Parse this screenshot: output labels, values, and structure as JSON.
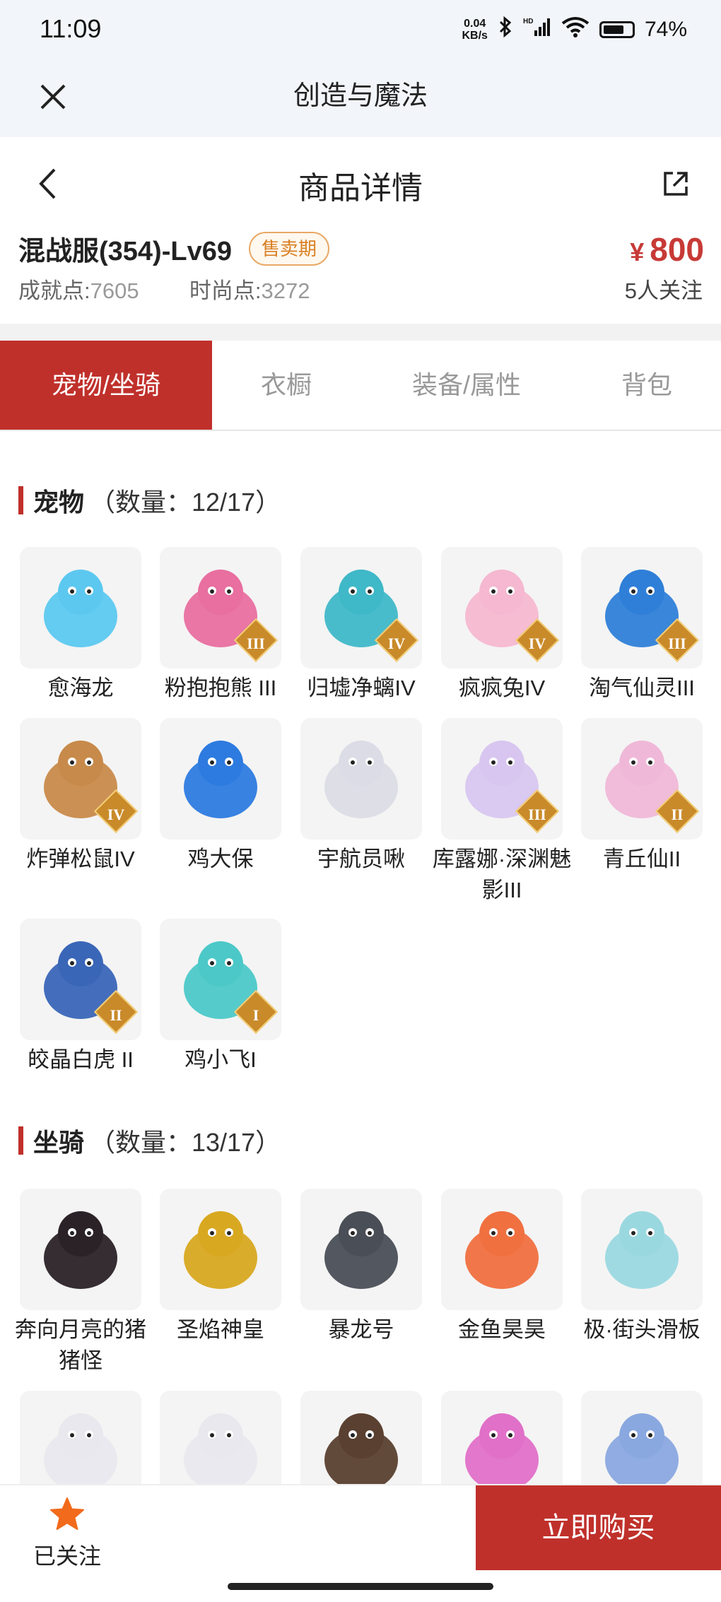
{
  "status": {
    "time": "11:09",
    "net_speed": "0.04",
    "net_unit": "KB/s",
    "battery": "74%",
    "battery_level": 0.74
  },
  "app": {
    "title": "创造与魔法"
  },
  "nav": {
    "title": "商品详情"
  },
  "listing": {
    "server": "混战服(354)-Lv69",
    "badge": "售卖期",
    "price_symbol": "¥",
    "price": "800",
    "achievement_label": "成就点:",
    "achievement_value": "7605",
    "fashion_label": "时尚点:",
    "fashion_value": "3272",
    "followers": "5人关注"
  },
  "tabs": [
    {
      "label": "宠物/坐骑",
      "active": true
    },
    {
      "label": "衣橱",
      "active": false
    },
    {
      "label": "装备/属性",
      "active": false
    },
    {
      "label": "背包",
      "active": false
    }
  ],
  "pets": {
    "title": "宠物",
    "count": "（数量：12/17）",
    "items": [
      {
        "name": "愈海龙",
        "rank": "",
        "color": "#5cc8f0",
        "icon": "ice-dragon-icon"
      },
      {
        "name": "粉抱抱熊 III",
        "rank": "III",
        "color": "#e86fa0",
        "icon": "pink-bear-icon"
      },
      {
        "name": "归墟净螭IV",
        "rank": "IV",
        "color": "#3fb8c8",
        "icon": "jade-dragon-icon"
      },
      {
        "name": "疯疯兔IV",
        "rank": "IV",
        "color": "#f5b8d0",
        "icon": "rabbit-icon"
      },
      {
        "name": "淘气仙灵III",
        "rank": "III",
        "color": "#2f7fd8",
        "icon": "spirit-dog-icon"
      },
      {
        "name": "炸弹松鼠IV",
        "rank": "IV",
        "color": "#c88a4a",
        "icon": "squirrel-icon"
      },
      {
        "name": "鸡大保",
        "rank": "",
        "color": "#2d7be0",
        "icon": "blue-chicken-icon"
      },
      {
        "name": "宇航员啾",
        "rank": "",
        "color": "#dcdce6",
        "icon": "astronaut-icon"
      },
      {
        "name": "库露娜·深渊魅影III",
        "rank": "III",
        "color": "#d8c6f0",
        "icon": "kuluna-icon"
      },
      {
        "name": "青丘仙II",
        "rank": "II",
        "color": "#f0b8d8",
        "icon": "fox-fairy-icon"
      },
      {
        "name": "皎晶白虎 II",
        "rank": "II",
        "color": "#3a66b8",
        "icon": "white-tiger-icon"
      },
      {
        "name": "鸡小飞I",
        "rank": "I",
        "color": "#4cc8c8",
        "icon": "little-chicken-icon"
      }
    ]
  },
  "mounts": {
    "title": "坐骑",
    "count": "（数量：13/17）",
    "items": [
      {
        "name": "奔向月亮的猪猪怪",
        "rank": "",
        "color": "#2a2226",
        "icon": "pig-icon"
      },
      {
        "name": "圣焰神皇",
        "rank": "",
        "color": "#d8a820",
        "icon": "golden-phoenix-icon"
      },
      {
        "name": "暴龙号",
        "rank": "",
        "color": "#4a4e56",
        "icon": "mech-icon"
      },
      {
        "name": "金鱼昊昊",
        "rank": "",
        "color": "#f07040",
        "icon": "goldfish-icon"
      },
      {
        "name": "极·街头滑板",
        "rank": "",
        "color": "#9ad8e0",
        "icon": "skateboard-icon"
      },
      {
        "name": "",
        "rank": "",
        "color": "#e8e8ee",
        "icon": "white-beast-icon"
      },
      {
        "name": "",
        "rank": "",
        "color": "#e8e8ee",
        "icon": "white-beast-icon"
      },
      {
        "name": "",
        "rank": "",
        "color": "#5a4030",
        "icon": "bug-creature-icon"
      },
      {
        "name": "",
        "rank": "",
        "color": "#e070c8",
        "icon": "heart-portal-icon"
      },
      {
        "name": "",
        "rank": "",
        "color": "#8aa8e0",
        "icon": "owl-icon"
      }
    ]
  },
  "bottom": {
    "follow_label": "已关注",
    "buy_label": "立即购买"
  }
}
